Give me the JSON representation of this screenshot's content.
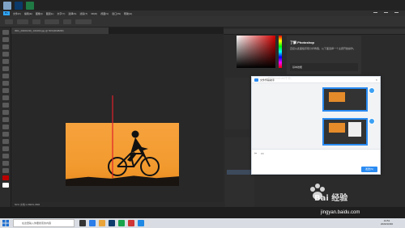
{
  "photoshop": {
    "logo": "Ps",
    "menu": [
      "文件(F)",
      "编辑(E)",
      "图像(I)",
      "图层(L)",
      "文字(Y)",
      "选择(S)",
      "滤镜(T)",
      "3D(D)",
      "视图(V)",
      "窗口(W)",
      "帮助(H)"
    ],
    "document_tab": "IMG_20201030_134400.jpg @ 50%(RGB/8#)",
    "status": "50%   文档:1.88M/1.88M"
  },
  "learn_panel": {
    "title": "了解 Photoshop",
    "description": "直接从此面板获取分步教程，从下面选择一个主题开始操作。",
    "tile_label": "基本技能"
  },
  "chat_window": {
    "header": "我的Android手机",
    "title": "文件传输助手",
    "send_label": "发送(S)",
    "close": "×"
  },
  "watermark": {
    "brand": "Bai 经验",
    "site": "jingyan.baidu.com"
  },
  "taskbar": {
    "search_placeholder": "在这里输入你要搜索的内容",
    "time": "13:51",
    "date": "2020/10/30"
  },
  "colors": {
    "sunset": "#f6a23d",
    "accent": "#2a8bf2",
    "ps_blue": "#31a8ff"
  }
}
